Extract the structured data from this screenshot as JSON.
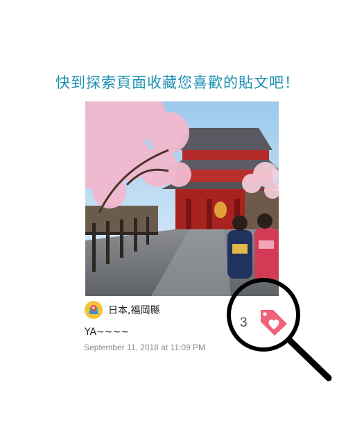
{
  "headline": "快到探索頁面收藏您喜歡的貼文吧！",
  "post": {
    "location": "日本,福岡縣",
    "caption": "YA~~~~",
    "timestamp": "September 11, 2018 at 11:09 PM",
    "like_count": "3"
  },
  "colors": {
    "headline": "#1a8fb0",
    "location_badge": "#f5c339",
    "like_tag": "#f0637a",
    "magnifier": "#000000"
  },
  "icons": [
    "location-pin-icon",
    "heart-tag-icon",
    "magnifier-icon"
  ]
}
